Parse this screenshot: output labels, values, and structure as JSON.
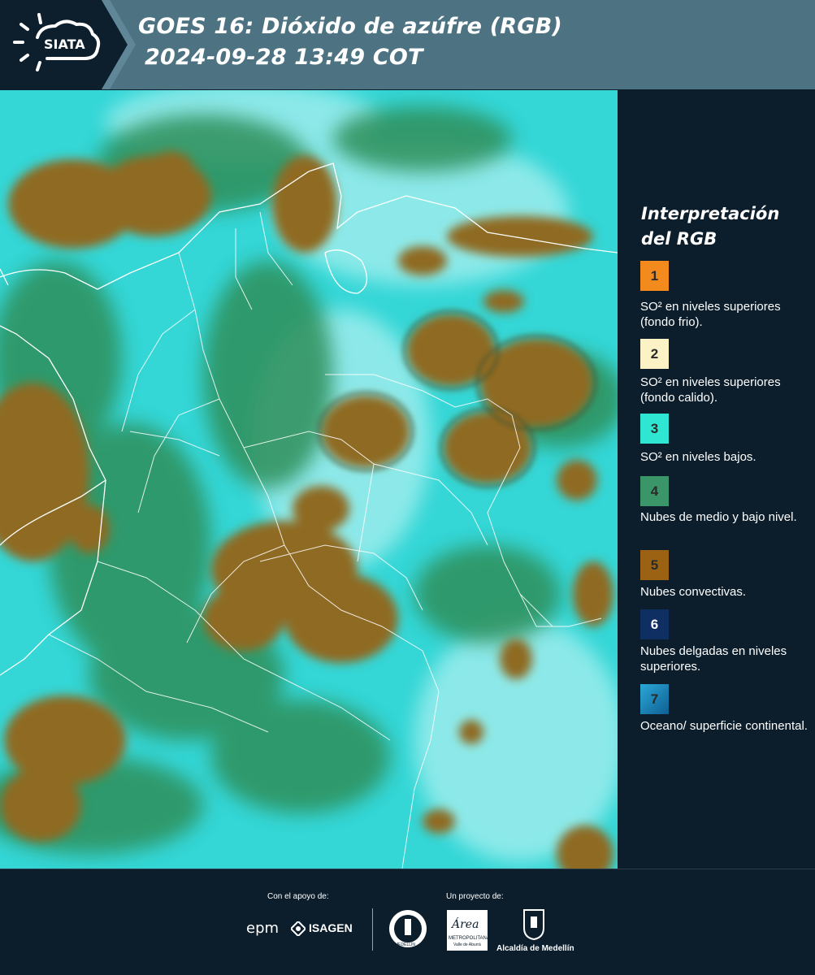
{
  "header": {
    "logo_text": "SIATA",
    "title_line1": "GOES 16: Dióxido de azúfre (RGB)",
    "title_line2": "2024-09-28 13:49 COT"
  },
  "legend": {
    "title_line1": "Interpretación",
    "title_line2": "del RGB",
    "items": [
      {
        "number": "1",
        "color": "#f28a1e",
        "desc": "SO² en niveles superiores (fondo frio)."
      },
      {
        "number": "2",
        "color": "#fbf2c6",
        "desc": "SO² en niveles superiores (fondo calido)."
      },
      {
        "number": "3",
        "color": "#2fe6d2",
        "desc": "SO² en niveles bajos."
      },
      {
        "number": "4",
        "color": "#3a9669",
        "desc": "Nubes de medio y bajo nivel."
      },
      {
        "number": "5",
        "color": "#9a6212",
        "desc": "Nubes convectivas."
      },
      {
        "number": "6",
        "color": "#0f2f63",
        "desc": "Nubes delgadas en niveles superiores."
      },
      {
        "number": "7",
        "color": "#1b86b8",
        "desc": "Oceano/ superficie continental."
      }
    ]
  },
  "footer": {
    "support_label": "Con el apoyo de:",
    "project_label": "Un proyecto de:",
    "logo_epm": "epm",
    "logo_isagen": "ISAGEN",
    "logo_metro": "METROPOLITANA",
    "logo_metro_sub": "Valle de Aburrá",
    "logo_metro_script": "Área",
    "logo_medellin": "Alcaldía de Medellín",
    "logo_seal_text": "MEDELLÍN"
  },
  "colors": {
    "header_dark": "#0d1f2d",
    "header_band": "#4d7382",
    "panel_bg": "#0c1e2c",
    "sea_cyan": "#2fd4d4",
    "convective_brown": "#8f6a24",
    "low_cloud_green": "#2f8f5a"
  }
}
